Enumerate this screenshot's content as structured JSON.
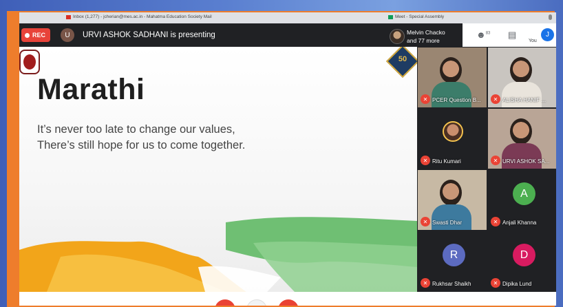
{
  "browser": {
    "tab_gmail": "Inbox (1,277) - jcherian@mes.ac.in - Mahatma Education Society Mail",
    "tab_meet": "Meet - Special Assembly"
  },
  "meet_bar": {
    "rec_label": "REC",
    "presenter_initial": "U",
    "presenting_text": "URVI ASHOK SADHANI is presenting",
    "others_line1": "Melvin Chacko",
    "others_line2": "and 77 more",
    "people_badge": "83",
    "you_label": "You",
    "you_initial": "J"
  },
  "slide": {
    "title": "Marathi",
    "line1": "It’s never too late to change our values,",
    "line2": "There’s still hope for us to come together.",
    "badge_number": "50"
  },
  "participants": [
    {
      "name": "PCER Question B..."
    },
    {
      "name": "ALISHA HANIF ..."
    },
    {
      "name": "Ritu Kumari"
    },
    {
      "name": "URVI ASHOK SA..."
    },
    {
      "name": "Swasti Dhar"
    },
    {
      "name": "Anjali Khanna",
      "initial": "A",
      "color": "#4caf50"
    },
    {
      "name": "Rukhsar Shaikh",
      "initial": "R",
      "color": "#5c6bc0"
    },
    {
      "name": "Dipika Lund",
      "initial": "D",
      "color": "#d81b60"
    }
  ],
  "colors": {
    "frame": "#ee7d2c",
    "rec": "#e8433a",
    "mute": "#ea4335"
  },
  "icons": [
    "mic-icon",
    "people-icon",
    "chat-icon",
    "mic-off-icon"
  ]
}
